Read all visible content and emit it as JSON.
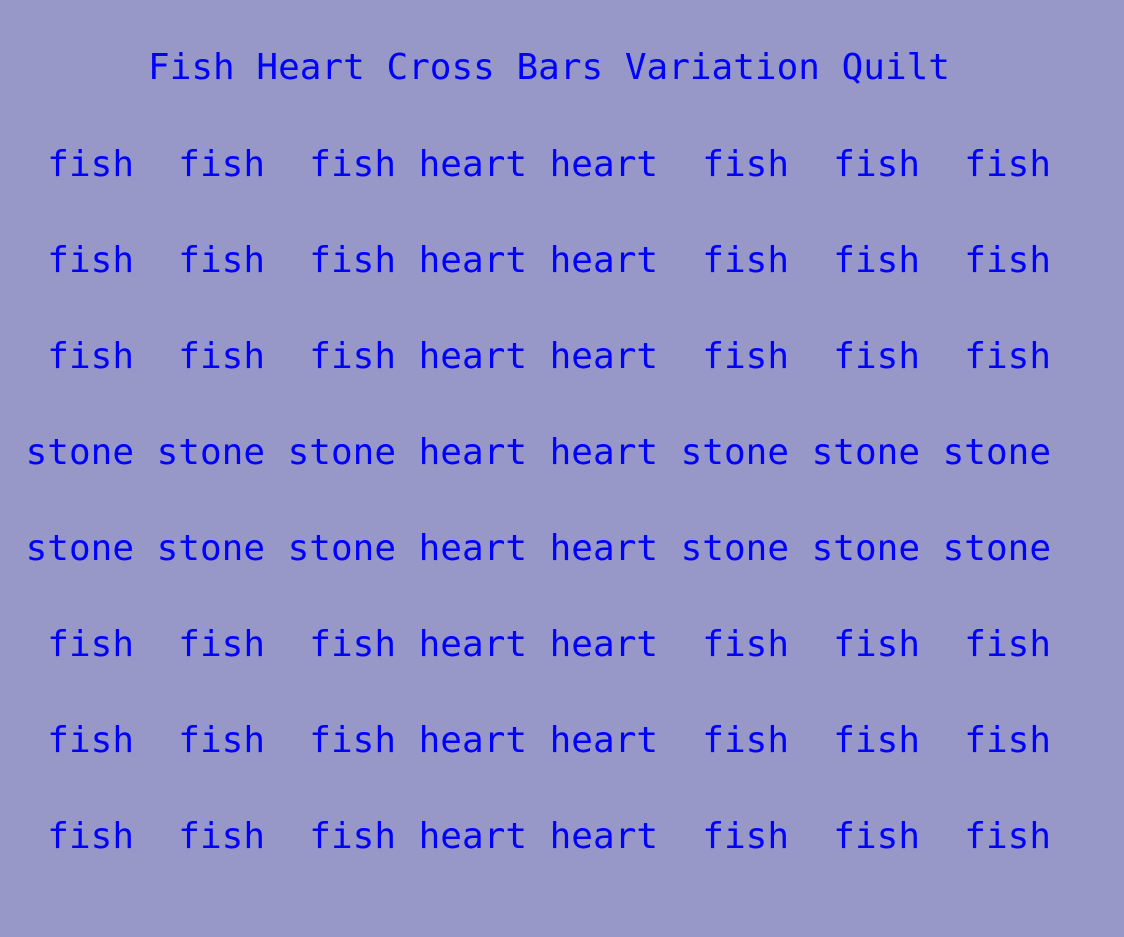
{
  "title": "Fish Heart Cross Bars Variation Quilt",
  "colors": {
    "background": "#9898c8",
    "text": "#0000ff"
  },
  "grid": [
    [
      "fish",
      "fish",
      "fish",
      "heart",
      "heart",
      "fish",
      "fish",
      "fish"
    ],
    [
      "fish",
      "fish",
      "fish",
      "heart",
      "heart",
      "fish",
      "fish",
      "fish"
    ],
    [
      "fish",
      "fish",
      "fish",
      "heart",
      "heart",
      "fish",
      "fish",
      "fish"
    ],
    [
      "stone",
      "stone",
      "stone",
      "heart",
      "heart",
      "stone",
      "stone",
      "stone"
    ],
    [
      "stone",
      "stone",
      "stone",
      "heart",
      "heart",
      "stone",
      "stone",
      "stone"
    ],
    [
      "fish",
      "fish",
      "fish",
      "heart",
      "heart",
      "fish",
      "fish",
      "fish"
    ],
    [
      "fish",
      "fish",
      "fish",
      "heart",
      "heart",
      "fish",
      "fish",
      "fish"
    ],
    [
      "fish",
      "fish",
      "fish",
      "heart",
      "heart",
      "fish",
      "fish",
      "fish"
    ]
  ]
}
